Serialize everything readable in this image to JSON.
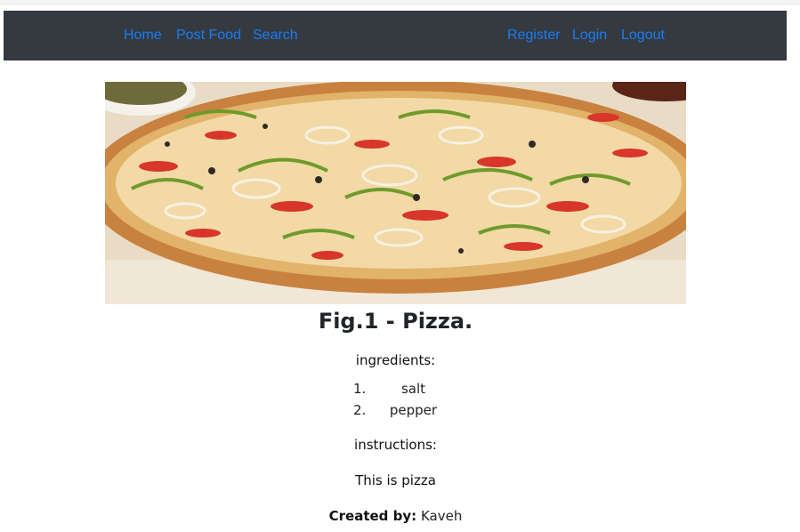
{
  "nav": {
    "left": [
      {
        "label": "Home"
      },
      {
        "label": "Post Food"
      },
      {
        "label": "Search"
      }
    ],
    "right": [
      {
        "label": "Register"
      },
      {
        "label": "Login"
      },
      {
        "label": "Logout"
      }
    ]
  },
  "post": {
    "image_alt": "pizza photo",
    "caption": "Fig.1 - Pizza.",
    "ingredients_label": "ingredients:",
    "ingredients": [
      {
        "num": "1.",
        "name": "salt"
      },
      {
        "num": "2.",
        "name": "pepper"
      }
    ],
    "instructions_label": "instructions:",
    "instructions_text": "This is pizza",
    "created_by_label": "Created by:",
    "created_by_value": "Kaveh"
  },
  "colors": {
    "navbar_bg": "#343a40",
    "link": "#1a7cf5"
  }
}
